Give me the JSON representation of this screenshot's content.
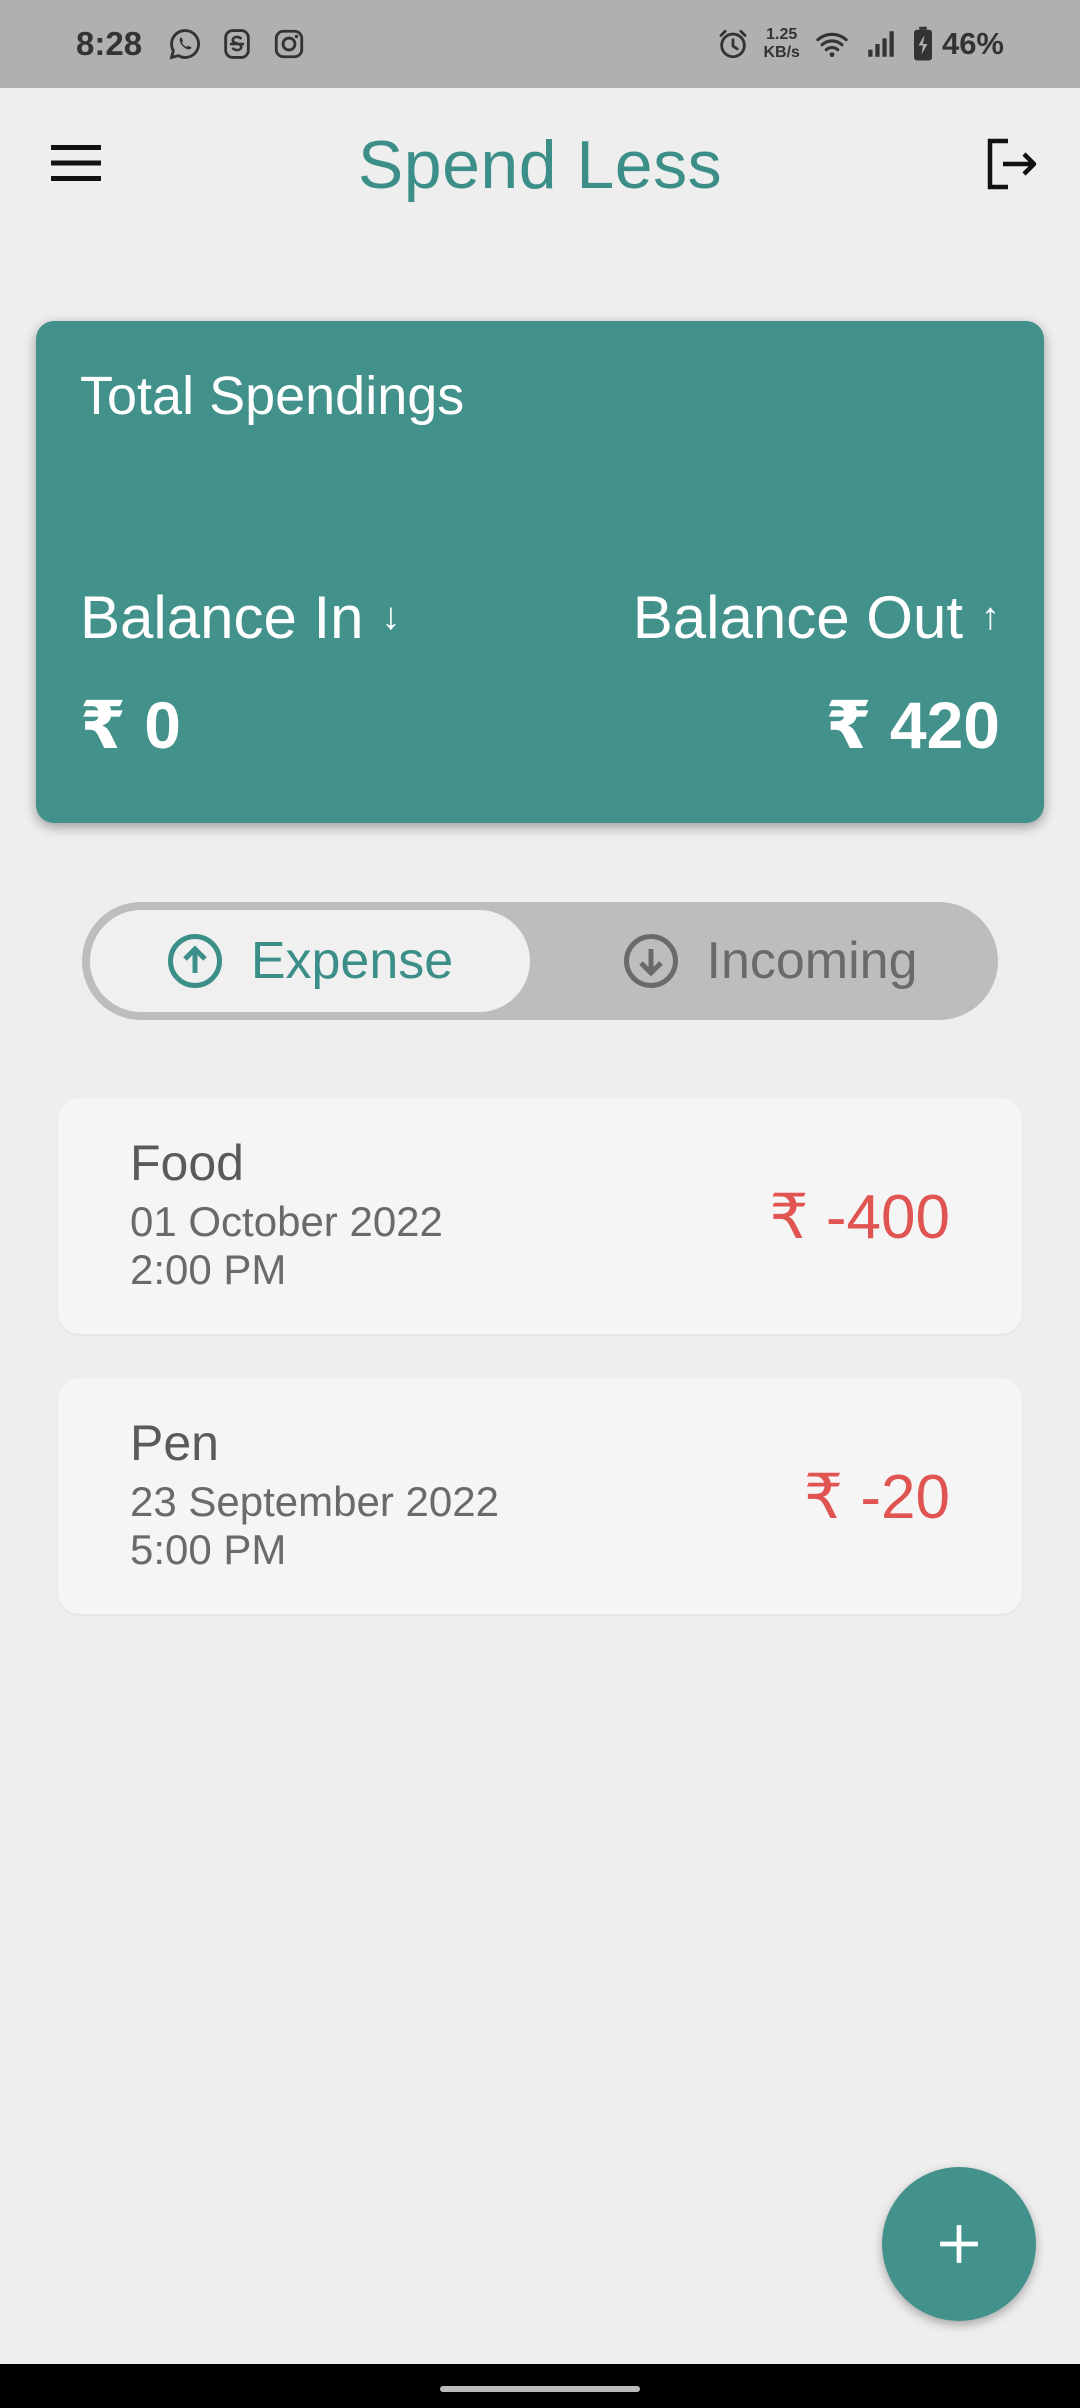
{
  "status_bar": {
    "time": "8:28",
    "net_speed_value": "1.25",
    "net_speed_unit": "KB/s",
    "battery": "46%",
    "icons": [
      "whatsapp-icon",
      "s-app-icon",
      "instagram-icon",
      "alarm-icon",
      "wifi-icon",
      "signal-icon",
      "battery-icon"
    ]
  },
  "app_bar": {
    "title": "Spend Less",
    "menu_icon": "menu-icon",
    "logout_icon": "logout-icon"
  },
  "summary": {
    "title": "Total Spendings",
    "balance_in_label": "Balance In",
    "balance_in_arrow": "↓",
    "balance_in_value": "₹ 0",
    "balance_out_label": "Balance Out",
    "balance_out_arrow": "↑",
    "balance_out_value": "₹ 420"
  },
  "toggle": {
    "expense_label": "Expense",
    "incoming_label": "Incoming",
    "selected": "Expense"
  },
  "transactions": [
    {
      "name": "Food",
      "date": "01 October 2022",
      "time": "2:00 PM",
      "amount": "₹ -400"
    },
    {
      "name": "Pen",
      "date": "23 September 2022",
      "time": "5:00 PM",
      "amount": "₹ -20"
    }
  ],
  "fab": {
    "icon": "plus-icon"
  },
  "colors": {
    "primary": "#42918b",
    "title_teal": "#3b8f88",
    "expense_red": "#e05452",
    "background": "#eeeeee"
  }
}
